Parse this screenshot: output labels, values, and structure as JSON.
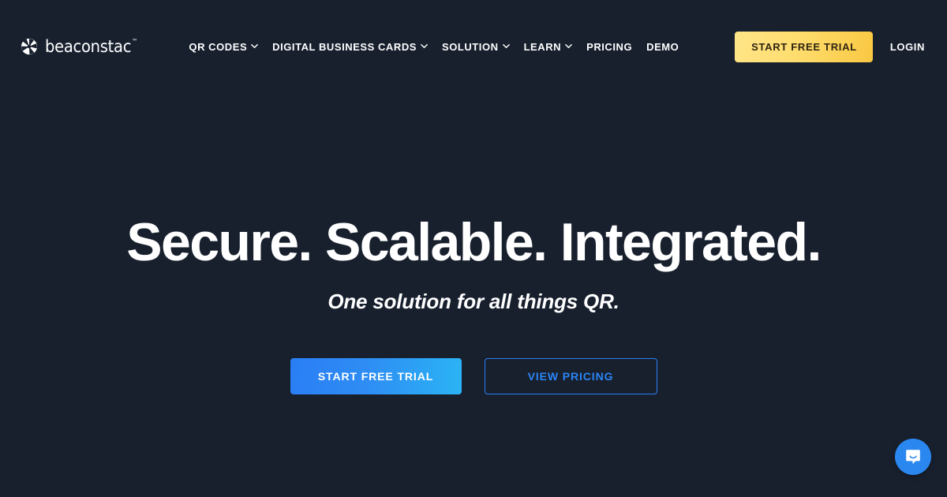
{
  "page": {
    "background_color": "#18202e"
  },
  "header": {
    "brand": {
      "name": "beaconstac",
      "trademark": "™",
      "icon": "beaconstac-pinwheel-logo-icon"
    },
    "nav_items": [
      {
        "label": "QR CODES",
        "has_dropdown": true
      },
      {
        "label": "DIGITAL BUSINESS CARDS",
        "has_dropdown": true
      },
      {
        "label": "SOLUTION",
        "has_dropdown": true
      },
      {
        "label": "LEARN",
        "has_dropdown": true
      },
      {
        "label": "PRICING",
        "has_dropdown": false
      },
      {
        "label": "DEMO",
        "has_dropdown": false
      }
    ],
    "actions": {
      "trial_label": "START FREE TRIAL",
      "trial_color": "#ffdd6e",
      "login_label": "LOGIN"
    }
  },
  "hero": {
    "title": "Secure. Scalable. Integrated.",
    "subtitle": "One solution for all things QR.",
    "primary_cta": {
      "label": "START FREE TRIAL",
      "color": "#2a7ef5"
    },
    "secondary_cta": {
      "label": "VIEW PRICING",
      "color": "#2a85f5"
    }
  },
  "chat": {
    "icon": "chat-bubble-icon",
    "color": "#2a87f0"
  }
}
